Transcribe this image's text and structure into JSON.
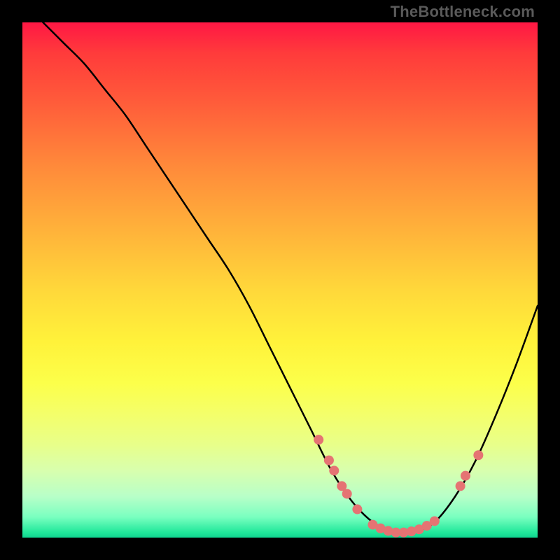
{
  "watermark": "TheBottleneck.com",
  "chart_data": {
    "type": "line",
    "title": "",
    "xlabel": "",
    "ylabel": "",
    "xlim": [
      0,
      100
    ],
    "ylim": [
      0,
      100
    ],
    "grid": false,
    "legend": false,
    "series": [
      {
        "name": "curve",
        "x": [
          4,
          8,
          12,
          16,
          20,
          24,
          28,
          32,
          36,
          40,
          44,
          48,
          52,
          56,
          60,
          64,
          68,
          72,
          76,
          80,
          84,
          88,
          92,
          96,
          100
        ],
        "y": [
          100,
          96,
          92,
          87,
          82,
          76,
          70,
          64,
          58,
          52,
          45,
          37,
          29,
          21,
          13,
          7,
          3,
          1,
          1,
          3,
          8,
          15,
          24,
          34,
          45
        ],
        "color": "#000000"
      }
    ],
    "markers": {
      "name": "dots",
      "color": "#e57373",
      "radius_px": 7,
      "points": [
        {
          "x": 57.5,
          "y": 19
        },
        {
          "x": 59.5,
          "y": 15
        },
        {
          "x": 60.5,
          "y": 13
        },
        {
          "x": 62.0,
          "y": 10
        },
        {
          "x": 63.0,
          "y": 8.5
        },
        {
          "x": 65.0,
          "y": 5.5
        },
        {
          "x": 68.0,
          "y": 2.5
        },
        {
          "x": 69.5,
          "y": 1.8
        },
        {
          "x": 71.0,
          "y": 1.3
        },
        {
          "x": 72.5,
          "y": 1.0
        },
        {
          "x": 74.0,
          "y": 1.0
        },
        {
          "x": 75.5,
          "y": 1.2
        },
        {
          "x": 77.0,
          "y": 1.6
        },
        {
          "x": 78.5,
          "y": 2.3
        },
        {
          "x": 80.0,
          "y": 3.2
        },
        {
          "x": 85.0,
          "y": 10
        },
        {
          "x": 86.0,
          "y": 12
        },
        {
          "x": 88.5,
          "y": 16
        }
      ]
    },
    "background_gradient": {
      "type": "vertical",
      "stops": [
        {
          "pos": 0.0,
          "color": "#ff1744"
        },
        {
          "pos": 0.3,
          "color": "#ff8a3a"
        },
        {
          "pos": 0.6,
          "color": "#fff23a"
        },
        {
          "pos": 0.9,
          "color": "#b8ffc8"
        },
        {
          "pos": 1.0,
          "color": "#10d490"
        }
      ]
    }
  }
}
